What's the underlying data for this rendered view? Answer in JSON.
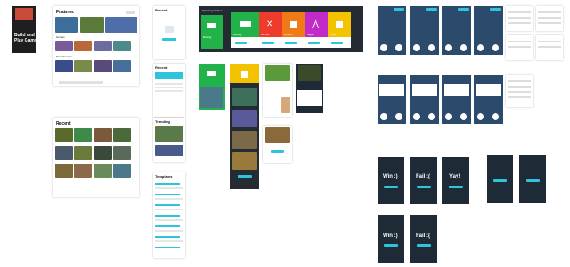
{
  "hero": {
    "title_line1": "Build and",
    "title_line2": "Play Games"
  },
  "phone_featured": {
    "title": "Featured",
    "section_games": "Games",
    "section_most_popular": "Most Popular"
  },
  "phone_recent": {
    "title": "Recent"
  },
  "phone_empty": {
    "title": "Recent"
  },
  "phone_recent2": {
    "title": "Recent"
  },
  "phone_trending": {
    "title": "Trending"
  },
  "phone_templates": {
    "title": "Templates"
  },
  "category_select": {
    "title": "Spinning witches",
    "tiles": [
      {
        "label": "Racing",
        "color": "#21b34a"
      },
      {
        "label": "Racing",
        "color": "#21b34a"
      },
      {
        "label": "Versus",
        "color": "#ef3b2c"
      },
      {
        "label": "Runner",
        "color": "#f07a17"
      },
      {
        "label": "Magic",
        "color": "#c229c9"
      },
      {
        "label": "Jump",
        "color": "#f3c300"
      }
    ]
  },
  "endscreens": {
    "win1": "Win :)",
    "fail1": "Fail :(",
    "yay": "Yay!",
    "win2": "Win :)",
    "fail2": "Fail :("
  },
  "colors": {
    "accent": "#2ec5dc",
    "dark_bg": "#1e2a36",
    "game_bg": "#2c4a6b",
    "green": "#21b34a",
    "yellow": "#f3c300",
    "red": "#ef3b2c"
  }
}
